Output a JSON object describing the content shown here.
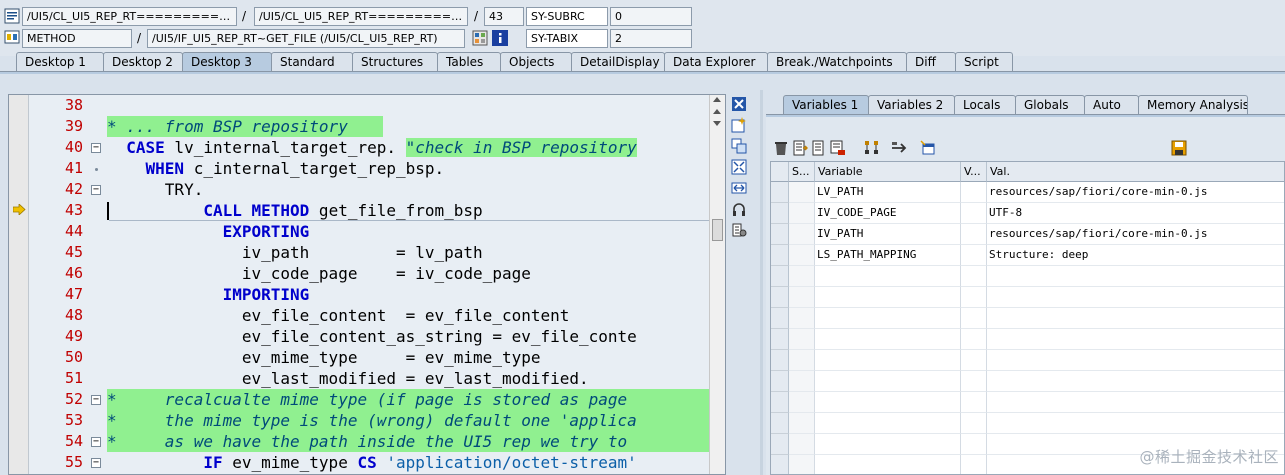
{
  "header": {
    "row1": {
      "program": "/UI5/CL_UI5_REP_RT===========...",
      "include": "/UI5/CL_UI5_REP_RT===========...",
      "line": "43",
      "sysvar_name": "SY-SUBRC",
      "sysvar_value": "0"
    },
    "row2": {
      "event_type": "METHOD",
      "event": "/UI5/IF_UI5_REP_RT~GET_FILE (/UI5/CL_UI5_REP_RT)",
      "sysvar_name": "SY-TABIX",
      "sysvar_value": "2"
    },
    "separator": "/"
  },
  "main_tabs": [
    "Desktop 1",
    "Desktop 2",
    "Desktop 3",
    "Standard",
    "Structures",
    "Tables",
    "Objects",
    "DetailDisplay",
    "Data Explorer",
    "Break./Watchpoints",
    "Diff",
    "Script"
  ],
  "main_tab_active": "Desktop 3",
  "code": {
    "line_numbers": [
      "38",
      "39",
      "40",
      "41",
      "42",
      "43",
      "44",
      "45",
      "46",
      "47",
      "48",
      "49",
      "50",
      "51",
      "52",
      "53",
      "54",
      "55"
    ],
    "current_line": "43"
  },
  "variable_tabs": [
    "Variables 1",
    "Variables 2",
    "Locals",
    "Globals",
    "Auto",
    "Memory Analysis"
  ],
  "variable_tab_active": "Variables 1",
  "variables": {
    "headers": [
      "S...",
      "Variable",
      "V...",
      "Val."
    ],
    "rows": [
      {
        "name": "LV_PATH",
        "value": "resources/sap/fiori/core-min-0.js"
      },
      {
        "name": "IV_CODE_PAGE",
        "value": "UTF-8"
      },
      {
        "name": "IV_PATH",
        "value": "resources/sap/fiori/core-min-0.js"
      },
      {
        "name": "LS_PATH_MAPPING",
        "value": "Structure: deep"
      }
    ]
  },
  "watermark": "@稀土掘金技术社区",
  "colors": {
    "comment_bg": "#90f090",
    "keyword": "#0000cc",
    "line_number": "#c00000",
    "active_tab": "#b7cbe0"
  }
}
